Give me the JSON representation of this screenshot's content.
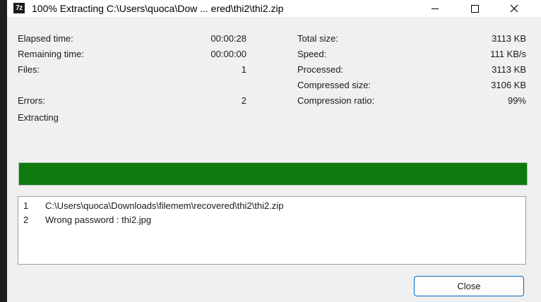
{
  "window": {
    "icon_text": "7z",
    "title": "100% Extracting C:\\Users\\quoca\\Dow ... ered\\thi2\\thi2.zip"
  },
  "stats_left": [
    {
      "label": "Elapsed time:",
      "value": "00:00:28"
    },
    {
      "label": "Remaining time:",
      "value": "00:00:00"
    },
    {
      "label": "Files:",
      "value": "1"
    },
    {
      "label": "Errors:",
      "value": "2"
    }
  ],
  "stats_right": [
    {
      "label": "Total size:",
      "value": "3113 KB"
    },
    {
      "label": "Speed:",
      "value": "111 KB/s"
    },
    {
      "label": "Processed:",
      "value": "3113 KB"
    },
    {
      "label": "Compressed size:",
      "value": "3106 KB"
    },
    {
      "label": "Compression ratio:",
      "value": "99%"
    }
  ],
  "status": "Extracting",
  "progress": {
    "percent": 100,
    "color": "#0f7b0f"
  },
  "log": [
    {
      "num": "1",
      "message": "C:\\Users\\quoca\\Downloads\\filemem\\recovered\\thi2\\thi2.zip"
    },
    {
      "num": "2",
      "message": "Wrong password : thi2.jpg"
    }
  ],
  "buttons": {
    "close_label": "Close"
  },
  "colors": {
    "accent": "#0067c0",
    "progress": "#0f7b0f"
  }
}
